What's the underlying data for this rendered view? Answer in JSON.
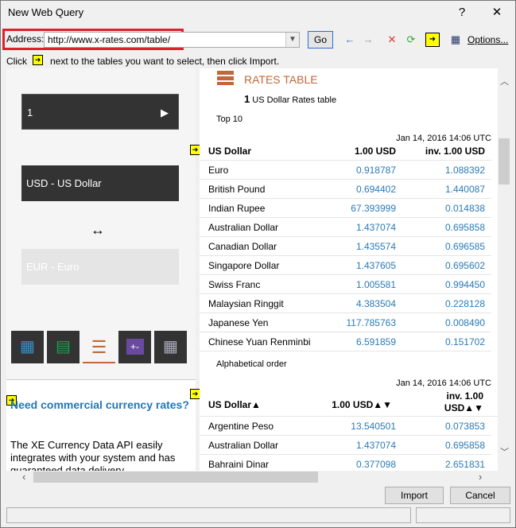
{
  "window": {
    "title": "New Web Query",
    "help": "?",
    "close": "✕"
  },
  "toolbar": {
    "address_label": "Address:",
    "address_value": "http://www.x-rates.com/table/",
    "go": "Go",
    "options": "Options..."
  },
  "instruction": {
    "prefix": "Click",
    "suffix": "next to the tables you want to select, then click Import."
  },
  "left_panel": {
    "amount": "1",
    "from": "USD - US Dollar",
    "swap": "↔",
    "to": "EUR - Euro",
    "ad_title": "Need commercial currency rates?",
    "ad_body": "The XE Currency Data API easily integrates with your system and has guaranteed data delivery."
  },
  "page": {
    "heading": "RATES TABLE",
    "sub_num": "1",
    "sub_text": "US Dollar Rates table",
    "top10": "Top 10",
    "date1": "Jan 14, 2016 14:06 UTC",
    "alpha": "Alphabetical order",
    "date2": "Jan 14, 2016 14:06 UTC",
    "table1": {
      "headers": [
        "US Dollar",
        "1.00 USD",
        "inv. 1.00 USD"
      ],
      "rows": [
        [
          "Euro",
          "0.918787",
          "1.088392"
        ],
        [
          "British Pound",
          "0.694402",
          "1.440087"
        ],
        [
          "Indian Rupee",
          "67.393999",
          "0.014838"
        ],
        [
          "Australian Dollar",
          "1.437074",
          "0.695858"
        ],
        [
          "Canadian Dollar",
          "1.435574",
          "0.696585"
        ],
        [
          "Singapore Dollar",
          "1.437605",
          "0.695602"
        ],
        [
          "Swiss Franc",
          "1.005581",
          "0.994450"
        ],
        [
          "Malaysian Ringgit",
          "4.383504",
          "0.228128"
        ],
        [
          "Japanese Yen",
          "117.785763",
          "0.008490"
        ],
        [
          "Chinese Yuan Renminbi",
          "6.591859",
          "0.151702"
        ]
      ]
    },
    "table2": {
      "headers": [
        "US Dollar▲",
        "1.00 USD▲▼",
        "inv. 1.00",
        "USD▲▼"
      ],
      "rows": [
        [
          "Argentine Peso",
          "13.540501",
          "0.073853"
        ],
        [
          "Australian Dollar",
          "1.437074",
          "0.695858"
        ],
        [
          "Bahraini Dinar",
          "0.377098",
          "2.651831"
        ]
      ]
    }
  },
  "buttons": {
    "import": "Import",
    "cancel": "Cancel"
  },
  "colors": {
    "accent": "#c0683a",
    "link": "#2a7ab8",
    "highlight": "#e0202a"
  }
}
